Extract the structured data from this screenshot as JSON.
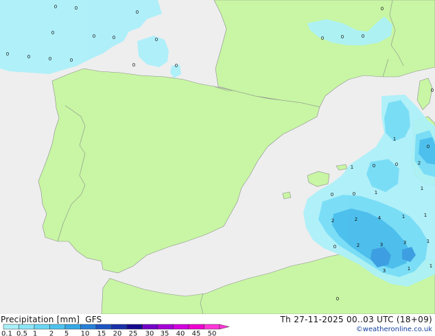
{
  "header": {
    "title_left": "Precipitation [mm]  GFS",
    "title_right": "Th 27-11-2025 00..03 UTC (18+09)",
    "copyright": "©weatheronline.co.uk"
  },
  "legend": {
    "ticks": [
      "0.1",
      "0.5",
      "1",
      "2",
      "5",
      "10",
      "15",
      "20",
      "25",
      "30",
      "35",
      "40",
      "45",
      "50"
    ],
    "colors": [
      "#aaf0fa",
      "#8de5f8",
      "#6ad6f4",
      "#4ec2ee",
      "#36a8e6",
      "#2780d8",
      "#1c54c4",
      "#1830aa",
      "#140a8e",
      "#7200c8",
      "#a600d8",
      "#d200e0",
      "#f000d0",
      "#ff36d8"
    ]
  },
  "map": {
    "colors": {
      "sea": "#eeeeee",
      "land": "#c8f6a4",
      "border": "#8c8c8c",
      "precip_light": "#aaf0fa",
      "precip_mid": "#72dcf4",
      "precip_heavy": "#4cbeec"
    },
    "labels": [
      "0",
      "0",
      "0",
      "0",
      "0",
      "0",
      "0",
      "0",
      "0",
      "0",
      "0",
      "0",
      "0",
      "0",
      "0",
      "0",
      "0",
      "0",
      "1",
      "0",
      "0",
      "2",
      "1",
      "0",
      "1",
      "1",
      "1",
      "0",
      "2",
      "2",
      "4",
      "1",
      "0",
      "0",
      "2",
      "3",
      "3",
      "1",
      "3",
      "1",
      "1",
      "0"
    ]
  }
}
